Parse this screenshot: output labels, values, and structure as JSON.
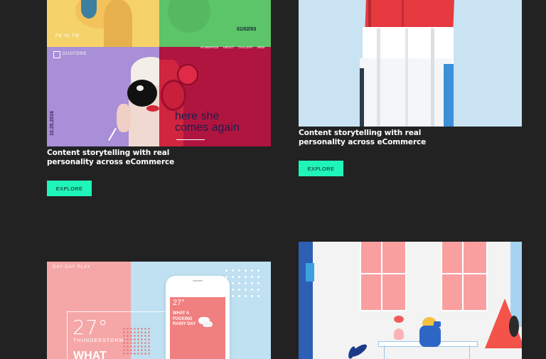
{
  "colors": {
    "background": "#222222",
    "accent": "#1ff5b8",
    "caption_text": "#ffffff"
  },
  "cards": [
    {
      "caption_line1": "Content storytelling with real",
      "caption_line2": "personality across eCommerce",
      "button_label": "EXPLORE",
      "artwork": {
        "brand": "DUOTONE",
        "counter": "01/02/03",
        "social": "FB IN TW",
        "nav": [
          "HOMEPAGE",
          "ABOUT",
          "GALLERY",
          "WEB"
        ],
        "headline_line1": "here she",
        "headline_line2": "comes again",
        "side_date": "10.25.2016"
      }
    },
    {
      "caption_line1": "Content storytelling with real",
      "caption_line2": "personality across eCommerce",
      "button_label": "EXPLORE"
    },
    {
      "artwork": {
        "tag": "DAY-DAY PLAY",
        "temperature": "27°",
        "condition": "THUNDERSTORM",
        "big_word": "WHAT",
        "phone_temp": "27°",
        "phone_text": "WHAT A FUCKING RAINY DAY"
      }
    },
    {}
  ]
}
